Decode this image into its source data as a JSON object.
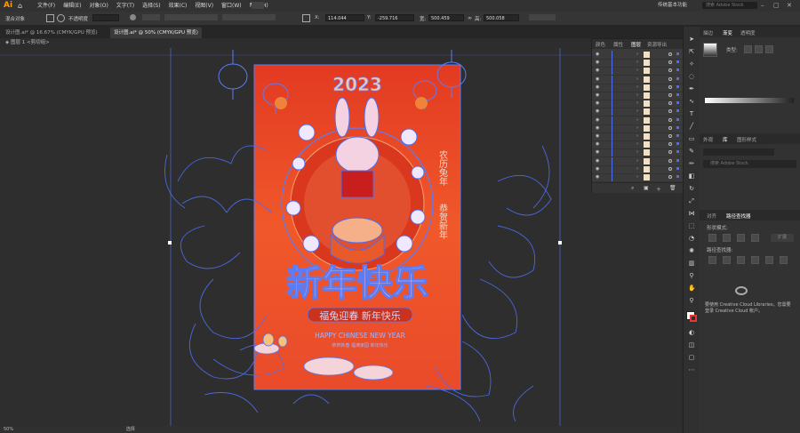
{
  "app": {
    "logo": "Ai",
    "home_icon": "home-icon"
  },
  "menus": [
    "文件(F)",
    "编辑(E)",
    "对象(O)",
    "文字(T)",
    "选择(S)",
    "效果(C)",
    "视图(V)",
    "窗口(W)",
    "帮助(H)"
  ],
  "workspace": "传统基本功能",
  "search": {
    "placeholder": "搜索 Adobe Stock"
  },
  "control": {
    "selection": "混合对象",
    "opacity_label": "不透明度",
    "x_label": "X:",
    "x_value": "114.044",
    "y_label": "Y:",
    "y_value": "-259.716",
    "w_label": "宽:",
    "w_value": "500.459",
    "h_label": "高:",
    "h_value": "500.058"
  },
  "tabs": [
    {
      "label": "设计图.ai* @ 16.67% (CMYK/GPU 预览)"
    },
    {
      "label": "设计图.ai* @ 50% (CMYK/GPU 预览)"
    }
  ],
  "breadcrumb": {
    "layer": "图层 1",
    "group": "<剪切组>"
  },
  "layers_panel": {
    "tabs": [
      "颜色",
      "属性",
      "图层",
      "资源导出"
    ],
    "active_tab": "图层",
    "row_count": 16
  },
  "right_panel": {
    "top_tabs": [
      "描边",
      "渐变",
      "透明度"
    ],
    "type_label": "类型:",
    "mid_tabs": [
      "外观",
      "库",
      "图形样式"
    ],
    "search_placeholder": "搜索 Adobe Stock",
    "align_tabs": [
      "对齐",
      "路径查找器"
    ],
    "shape_modes": "形状模式:",
    "expand_label": "扩展",
    "pathfinders": "路径查找器:",
    "cc_text": "要使用 Creative Cloud Libraries，您需要登录 Creative Cloud 帐户。"
  },
  "status": {
    "zoom": "50%",
    "selection_label": "选择"
  },
  "artwork": {
    "year": "2023",
    "title": "新年快乐",
    "subtitle": "福兔迎春 新年快乐",
    "english": "HAPPY CHINESE NEW YEAR",
    "small_line": "恭贺新春  福满家园  新年快乐",
    "side_text_1": "农历兔年",
    "side_text_2": "恭贺新年"
  },
  "colors": {
    "poster_red": "#e8442a",
    "poster_orange": "#f2622c",
    "outline_blue": "#4d6ef0",
    "accent": "#ff9a00"
  }
}
